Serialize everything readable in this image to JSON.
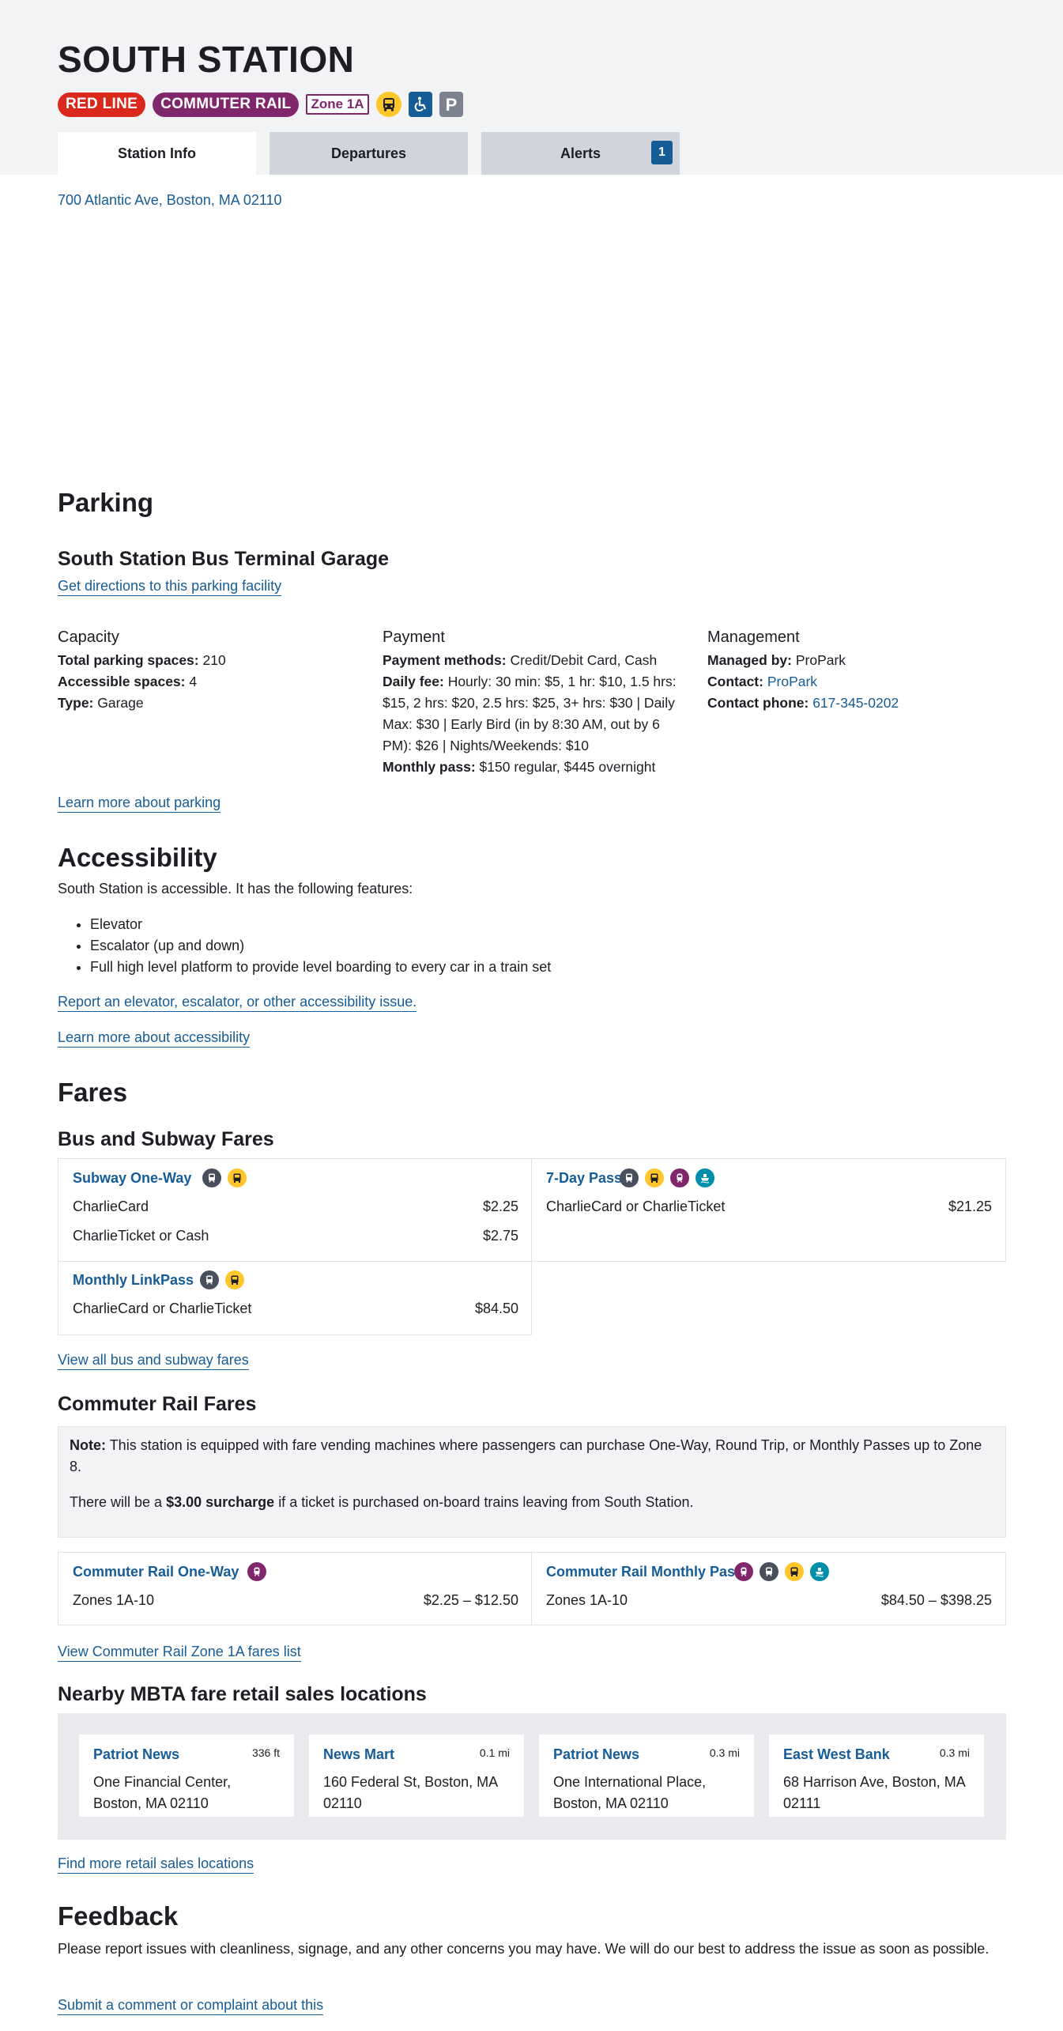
{
  "station": {
    "name": "SOUTH STATION",
    "badges": {
      "red_line": "RED LINE",
      "commuter_rail": "COMMUTER RAIL",
      "zone": "Zone 1A"
    },
    "address": "700 Atlantic Ave, Boston, MA 02110"
  },
  "tabs": [
    {
      "label": "Station Info"
    },
    {
      "label": "Departures"
    },
    {
      "label": "Alerts",
      "count": "1"
    }
  ],
  "parking": {
    "heading": "Parking",
    "facility_name": "South Station Bus Terminal Garage",
    "directions_link": "Get directions to this parking facility",
    "capacity": {
      "heading": "Capacity",
      "total_label": "Total parking spaces:",
      "total_value": "210",
      "accessible_label": "Accessible spaces:",
      "accessible_value": "4",
      "type_label": "Type:",
      "type_value": "Garage"
    },
    "payment": {
      "heading": "Payment",
      "methods_label": "Payment methods:",
      "methods_value": "Credit/Debit Card, Cash",
      "daily_label": "Daily fee:",
      "daily_value": "Hourly: 30 min: $5, 1 hr: $10, 1.5 hrs: $15, 2 hrs: $20, 2.5 hrs: $25, 3+ hrs: $30 | Daily Max: $30 | Early Bird (in by 8:30 AM, out by 6 PM): $26 | Nights/Weekends: $10",
      "monthly_label": "Monthly pass:",
      "monthly_value": "$150 regular, $445 overnight"
    },
    "management": {
      "heading": "Management",
      "managed_label": "Managed by:",
      "managed_value": "ProPark",
      "contact_label": "Contact:",
      "contact_value": "ProPark",
      "phone_label": "Contact phone:",
      "phone_value": "617-345-0202"
    },
    "learn_more": "Learn more about parking"
  },
  "accessibility": {
    "heading": "Accessibility",
    "intro": "South Station is accessible. It has the following features:",
    "features": [
      "Elevator",
      "Escalator (up and down)",
      "Full high level platform to provide level boarding to every car in a train set"
    ],
    "report_link": "Report an elevator, escalator, or other accessibility issue.",
    "learn_more": "Learn more about accessibility"
  },
  "fares": {
    "heading": "Fares",
    "bus_subway_heading": "Bus and Subway Fares",
    "subway_one_way": {
      "title": "Subway One-Way",
      "rows": [
        {
          "label": "CharlieCard",
          "price": "$2.25"
        },
        {
          "label": "CharlieTicket or Cash",
          "price": "$2.75"
        }
      ]
    },
    "seven_day": {
      "title": "7-Day Pass",
      "rows": [
        {
          "label": "CharlieCard or CharlieTicket",
          "price": "$21.25"
        }
      ]
    },
    "monthly_linkpass": {
      "title": "Monthly LinkPass",
      "rows": [
        {
          "label": "CharlieCard or CharlieTicket",
          "price": "$84.50"
        }
      ]
    },
    "view_all_link": "View all bus and subway fares",
    "commuter_heading": "Commuter Rail Fares",
    "note_label": "Note:",
    "note_text": "This station is equipped with fare vending machines where passengers can purchase One-Way, Round Trip, or Monthly Passes up to Zone 8.",
    "surcharge_pre": "There will be a",
    "surcharge_amount": "$3.00 surcharge",
    "surcharge_post": "if a ticket is purchased on-board trains leaving from South Station.",
    "cr_one_way": {
      "title": "Commuter Rail One-Way",
      "zones": "Zones 1A-10",
      "price": "$2.25 – $12.50"
    },
    "cr_monthly": {
      "title": "Commuter Rail Monthly Pass",
      "zones": "Zones 1A-10",
      "price": "$84.50 – $398.25"
    },
    "zone_link": "View Commuter Rail Zone 1A fares list"
  },
  "retail": {
    "heading": "Nearby MBTA fare retail sales locations",
    "locations": [
      {
        "name": "Patriot News",
        "distance": "336 ft",
        "address": "One Financial Center, Boston, MA 02110"
      },
      {
        "name": "News Mart",
        "distance": "0.1 mi",
        "address": "160 Federal St, Boston, MA 02110"
      },
      {
        "name": "Patriot News",
        "distance": "0.3 mi",
        "address": "One International Place, Boston, MA 02110"
      },
      {
        "name": "East West Bank",
        "distance": "0.3 mi",
        "address": "68 Harrison Ave, Boston, MA 02111"
      }
    ],
    "more_link": "Find more retail sales locations"
  },
  "feedback": {
    "heading": "Feedback",
    "text": "Please report issues with cleanliness, signage, and any other concerns you may have. We will do our best to address the issue as soon as possible.",
    "link": "Submit a comment or complaint about this"
  },
  "colors": {
    "red_line": "#da291c",
    "commuter_rail": "#80276c",
    "bus": "#ffc72c",
    "subway": "#494f5c",
    "ferry": "#008eaa",
    "link": "#165c96"
  },
  "icons": [
    "bus-icon",
    "accessible-icon",
    "parking-icon",
    "subway-icon",
    "commuter-rail-icon",
    "ferry-icon"
  ]
}
